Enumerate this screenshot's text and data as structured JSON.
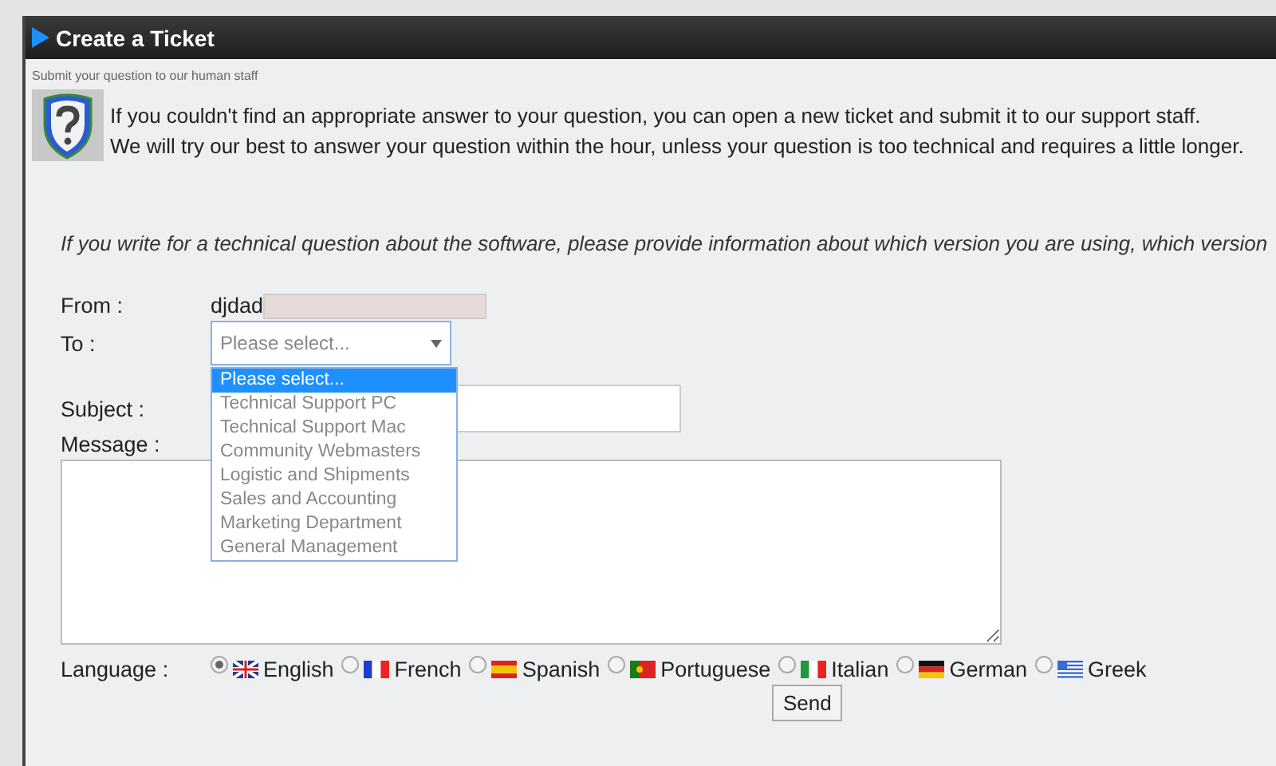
{
  "panel": {
    "title": "Create a Ticket",
    "subtitle": "Submit your question to our human staff"
  },
  "intro": [
    "If you couldn't find an appropriate answer to your question, you can open a new ticket and submit it to our support staff.",
    "We will try our best to answer your question within the hour, unless your question is too technical and requires a little longer."
  ],
  "notice": "If you write for a technical question about the software, please provide information about which version you are using, which version",
  "form": {
    "from_label": "From :",
    "from_value": "djdad",
    "to_label": "To :",
    "to_placeholder": "Please select...",
    "to_expanded": true,
    "to_options": [
      {
        "label": "Please select...",
        "selected": true
      },
      {
        "label": "Technical Support PC",
        "selected": false
      },
      {
        "label": "Technical Support Mac",
        "selected": false
      },
      {
        "label": "Community Webmasters",
        "selected": false
      },
      {
        "label": "Logistic and Shipments",
        "selected": false
      },
      {
        "label": "Sales and Accounting",
        "selected": false
      },
      {
        "label": "Marketing Department",
        "selected": false
      },
      {
        "label": "General Management",
        "selected": false
      }
    ],
    "subject_label": "Subject :",
    "message_label": "Message :",
    "language_label": "Language :",
    "languages": [
      {
        "label": "English",
        "kind": "uk",
        "selected": true
      },
      {
        "label": "French",
        "kind": "fr",
        "selected": false
      },
      {
        "label": "Spanish",
        "kind": "es",
        "selected": false
      },
      {
        "label": "Portuguese",
        "kind": "pt",
        "selected": false
      },
      {
        "label": "Italian",
        "kind": "it",
        "selected": false
      },
      {
        "label": "German",
        "kind": "de",
        "selected": false
      },
      {
        "label": "Greek",
        "kind": "gr",
        "selected": false
      }
    ],
    "send": "Send"
  }
}
